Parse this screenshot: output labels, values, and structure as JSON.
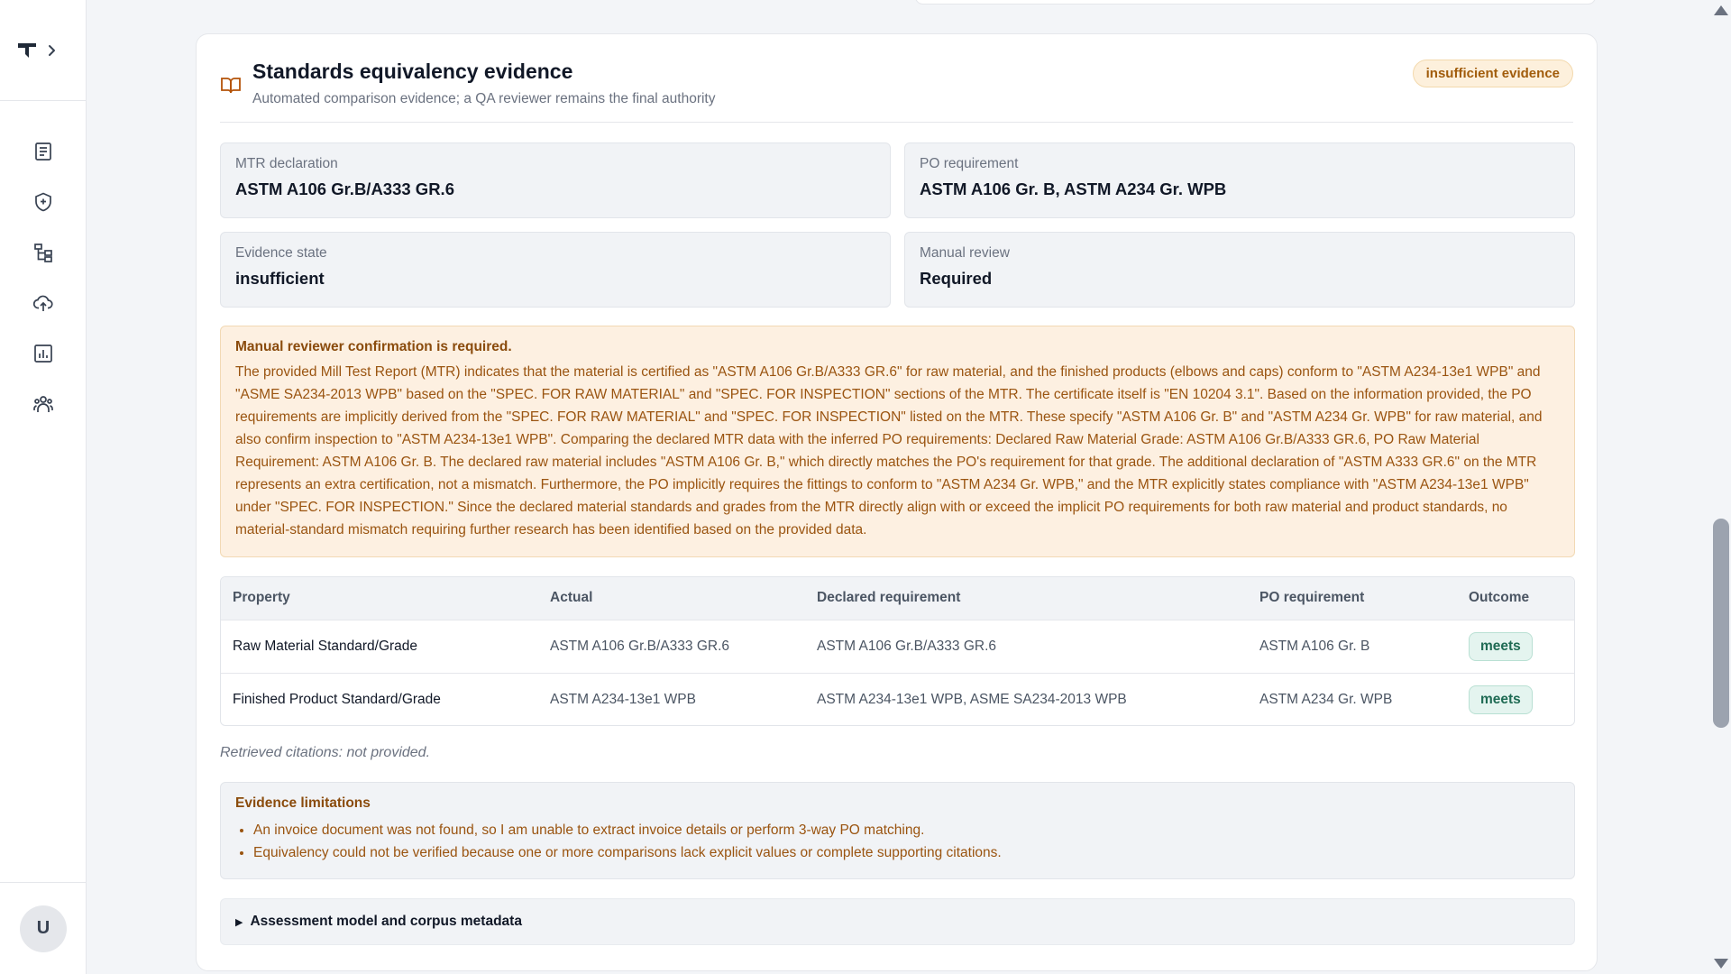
{
  "user": {
    "initial": "U"
  },
  "sidebar": {
    "nav": [
      {
        "name": "documents",
        "icon": "document-list-icon"
      },
      {
        "name": "compliance",
        "icon": "shield-plus-icon"
      },
      {
        "name": "hierarchy",
        "icon": "hierarchy-icon"
      },
      {
        "name": "upload",
        "icon": "cloud-upload-icon"
      },
      {
        "name": "reports",
        "icon": "bar-chart-icon"
      },
      {
        "name": "team",
        "icon": "users-icon"
      }
    ]
  },
  "card": {
    "title": "Standards equivalency evidence",
    "subtitle": "Automated comparison evidence; a QA reviewer remains the final authority",
    "status_badge": "insufficient evidence",
    "fields": {
      "mtr_declaration": {
        "label": "MTR declaration",
        "value": "ASTM A106 Gr.B/A333 GR.6"
      },
      "po_requirement": {
        "label": "PO requirement",
        "value": "ASTM A106 Gr. B, ASTM A234 Gr. WPB"
      },
      "evidence_state": {
        "label": "Evidence state",
        "value": "insufficient"
      },
      "manual_review": {
        "label": "Manual review",
        "value": "Required"
      }
    },
    "notice": {
      "title": "Manual reviewer confirmation is required.",
      "body": "The provided Mill Test Report (MTR) indicates that the material is certified as \"ASTM A106 Gr.B/A333 GR.6\" for raw material, and the finished products (elbows and caps) conform to \"ASTM A234-13e1 WPB\" and \"ASME SA234-2013 WPB\" based on the \"SPEC. FOR RAW MATERIAL\" and \"SPEC. FOR INSPECTION\" sections of the MTR. The certificate itself is \"EN 10204 3.1\". Based on the information provided, the PO requirements are implicitly derived from the \"SPEC. FOR RAW MATERIAL\" and \"SPEC. FOR INSPECTION\" listed on the MTR. These specify \"ASTM A106 Gr. B\" and \"ASTM A234 Gr. WPB\" for raw material, and also confirm inspection to \"ASTM A234-13e1 WPB\". Comparing the declared MTR data with the inferred PO requirements: Declared Raw Material Grade: ASTM A106 Gr.B/A333 GR.6, PO Raw Material Requirement: ASTM A106 Gr. B. The declared raw material includes \"ASTM A106 Gr. B,\" which directly matches the PO's requirement for that grade. The additional declaration of \"ASTM A333 GR.6\" on the MTR represents an extra certification, not a mismatch. Furthermore, the PO implicitly requires the fittings to conform to \"ASTM A234 Gr. WPB,\" and the MTR explicitly states compliance with \"ASTM A234-13e1 WPB\" under \"SPEC. FOR INSPECTION.\" Since the declared material standards and grades from the MTR directly align with or exceed the implicit PO requirements for both raw material and product standards, no material-standard mismatch requiring further research has been identified based on the provided data."
    },
    "table": {
      "headers": [
        "Property",
        "Actual",
        "Declared requirement",
        "PO requirement",
        "Outcome"
      ],
      "rows": [
        [
          "Raw Material Standard/Grade",
          "ASTM A106 Gr.B/A333 GR.6",
          "ASTM A106 Gr.B/A333 GR.6",
          "ASTM A106 Gr. B",
          "meets"
        ],
        [
          "Finished Product Standard/Grade",
          "ASTM A234-13e1 WPB",
          "ASTM A234-13e1 WPB, ASME SA234-2013 WPB",
          "ASTM A234 Gr. WPB",
          "meets"
        ]
      ]
    },
    "citations_note": "Retrieved citations: not provided.",
    "limitations": {
      "title": "Evidence limitations",
      "items": [
        "An invoice document was not found, so I am unable to extract invoice details or perform 3-way PO matching.",
        "Equivalency could not be verified because one or more comparisons lack explicit values or complete supporting citations."
      ]
    },
    "metadata_toggle": "Assessment model and corpus metadata"
  }
}
